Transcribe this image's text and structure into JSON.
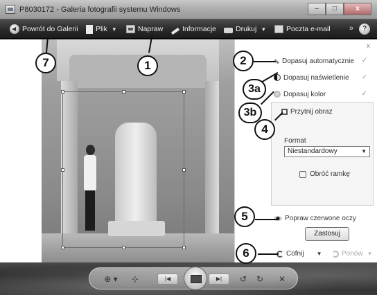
{
  "window": {
    "title": "P8030172 - Galeria fotografii systemu Windows",
    "minimize_label": "–",
    "maximize_label": "□",
    "close_label": "x"
  },
  "toolbar": {
    "back_label": "Powrót do Galerii",
    "file_label": "Plik",
    "fix_label": "Napraw",
    "info_label": "Informacje",
    "print_label": "Drukuj",
    "email_label": "Poczta e-mail",
    "more_label": "»",
    "help_label": "?"
  },
  "fix_panel": {
    "close_label": "x",
    "auto_adjust_label": "Dopasuj automatycznie",
    "exposure_label": "Dopasuj naświetlenie",
    "color_label": "Dopasuj kolor",
    "crop_label": "Przytnij obraz",
    "format_label": "Format",
    "format_value": "Niestandardowy",
    "rotate_frame_label": "Obróć ramkę",
    "apply_label": "Zastosuj",
    "redeye_label": "Popraw czerwone oczy",
    "undo_label": "Cofnij",
    "redo_label": "Ponów"
  },
  "bottom_controls": {
    "zoom_label": "⊕ ▾",
    "fit_label": "⊹",
    "prev_label": "|◀",
    "next_label": "▶|",
    "rotate_ccw_label": "↺",
    "rotate_cw_label": "↻",
    "delete_label": "✕"
  },
  "callouts": {
    "c1": "1",
    "c2": "2",
    "c3a": "3a",
    "c3b": "3b",
    "c4": "4",
    "c5": "5",
    "c6": "6",
    "c7": "7"
  }
}
